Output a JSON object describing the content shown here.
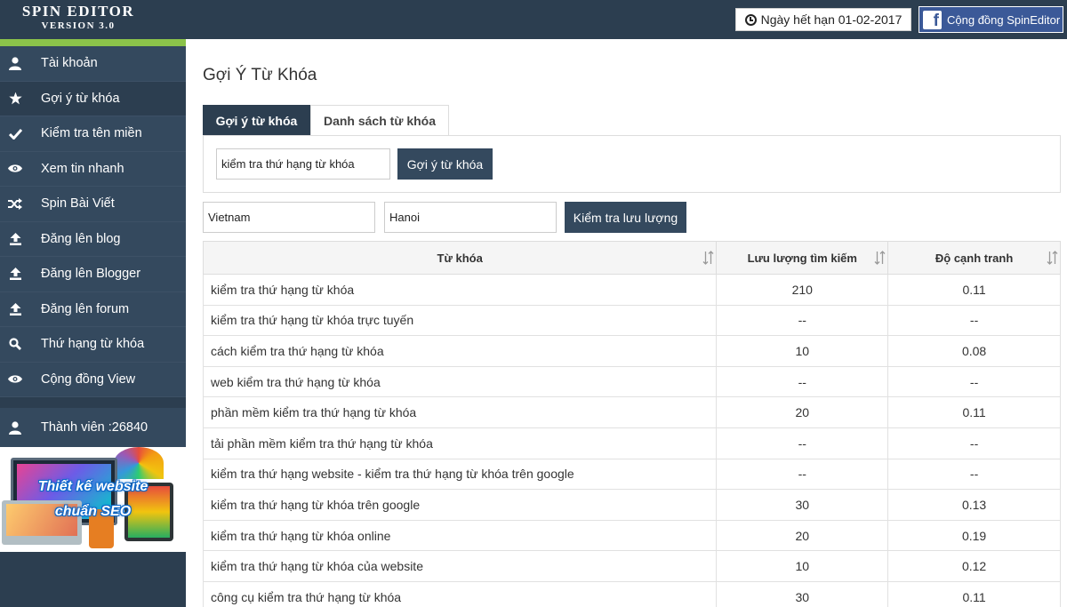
{
  "app": {
    "logo_title": "SPIN EDITOR",
    "logo_version": "VERSION 3.0",
    "expiry": "Ngày hết hạn 01-02-2017",
    "facebook_label": "Cộng đồng SpinEditor"
  },
  "sidebar": {
    "items": [
      {
        "label": "Tài khoản",
        "icon": "user-icon"
      },
      {
        "label": "Gợi ý từ khóa",
        "icon": "star-icon"
      },
      {
        "label": "Kiểm tra tên miền",
        "icon": "check-icon"
      },
      {
        "label": "Xem tin nhanh",
        "icon": "eye-icon"
      },
      {
        "label": "Spin Bài Viết",
        "icon": "shuffle-icon"
      },
      {
        "label": "Đăng lên blog",
        "icon": "upload-icon"
      },
      {
        "label": "Đăng lên Blogger",
        "icon": "upload-icon"
      },
      {
        "label": "Đăng lên forum",
        "icon": "upload-icon"
      },
      {
        "label": "Thứ hạng từ khóa",
        "icon": "search-icon"
      },
      {
        "label": "Cộng đồng View",
        "icon": "eye-icon"
      }
    ],
    "active_index": 1,
    "member_label": "Thành viên :26840",
    "banner_line1": "Thiết kế website",
    "banner_line2": "chuẩn SEO"
  },
  "main": {
    "title": "Gợi Ý Từ Khóa",
    "tabs": [
      {
        "label": "Gợi ý từ khóa",
        "active": true
      },
      {
        "label": "Danh sách từ khóa",
        "active": false
      }
    ],
    "keyword_input": "kiểm tra thứ hạng từ khóa",
    "suggest_button": "Gợi ý từ khóa",
    "country_input": "Vietnam",
    "city_input": "Hanoi",
    "traffic_button": "Kiểm tra lưu lượng",
    "table": {
      "headers": [
        "Từ khóa",
        "Lưu lượng tìm kiếm",
        "Độ cạnh tranh"
      ],
      "rows": [
        [
          "kiểm tra thứ hạng từ khóa",
          "210",
          "0.11"
        ],
        [
          "kiểm tra thứ hạng từ khóa trực tuyến",
          "--",
          "--"
        ],
        [
          "cách kiểm tra thứ hạng từ khóa",
          "10",
          "0.08"
        ],
        [
          "web kiểm tra thứ hạng từ khóa",
          "--",
          "--"
        ],
        [
          "phần mềm kiểm tra thứ hạng từ khóa",
          "20",
          "0.11"
        ],
        [
          "tải phần mềm kiểm tra thứ hạng từ khóa",
          "--",
          "--"
        ],
        [
          "kiểm tra thứ hạng website - kiểm tra thứ hạng từ khóa trên google",
          "--",
          "--"
        ],
        [
          "kiểm tra thứ hạng từ khóa trên google",
          "30",
          "0.13"
        ],
        [
          "kiểm tra thứ hạng từ khóa online",
          "20",
          "0.19"
        ],
        [
          "kiểm tra thứ hạng từ khóa của website",
          "10",
          "0.12"
        ],
        [
          "công cụ kiểm tra thứ hạng từ khóa",
          "30",
          "0.11"
        ]
      ]
    }
  }
}
